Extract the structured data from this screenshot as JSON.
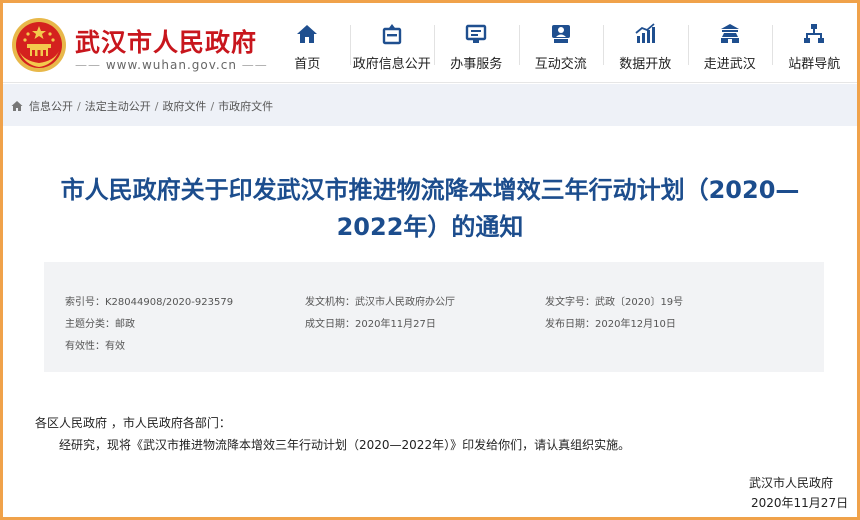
{
  "site": {
    "name": "武汉市人民政府",
    "url": "www.wuhan.gov.cn"
  },
  "nav": [
    {
      "label": "首页",
      "icon": "home-icon"
    },
    {
      "label": "政府信息公开",
      "icon": "info-disclosure-icon"
    },
    {
      "label": "办事服务",
      "icon": "service-icon"
    },
    {
      "label": "互动交流",
      "icon": "interaction-icon"
    },
    {
      "label": "数据开放",
      "icon": "data-chart-icon"
    },
    {
      "label": "走进武汉",
      "icon": "building-icon"
    },
    {
      "label": "站群导航",
      "icon": "sitemap-icon"
    }
  ],
  "breadcrumb": [
    "信息公开",
    "法定主动公开",
    "政府文件",
    "市政府文件"
  ],
  "article": {
    "title": "市人民政府关于印发武汉市推进物流降本增效三年行动计划（2020—2022年）的通知",
    "meta": {
      "index_label": "索引号：",
      "index_value": "K28044908/2020-923579",
      "issuer_label": "发文机构：",
      "issuer_value": "武汉市人民政府办公厅",
      "doc_no_label": "发文字号：",
      "doc_no_value": "武政〔2020〕19号",
      "topic_label": "主题分类：",
      "topic_value": "邮政",
      "written_label": "成文日期：",
      "written_value": "2020年11月27日",
      "publish_label": "发布日期：",
      "publish_value": "2020年12月10日",
      "validity_label": "有效性：",
      "validity_value": "有效"
    },
    "greeting": "各区人民政府 ，市人民政府各部门：",
    "paragraph": "经研究，现将《武汉市推进物流降本增效三年行动计划（2020—2022年）》印发给你们，请认真组织实施。",
    "signature_org": "武汉市人民政府",
    "signature_date": "2020年11月27日"
  },
  "colors": {
    "brand_red": "#c8161d",
    "title_blue": "#1c4d8d",
    "nav_icon_blue": "#1f4f8f",
    "frame_orange": "#f0a24a",
    "crumb_bg": "#eef1f7"
  }
}
